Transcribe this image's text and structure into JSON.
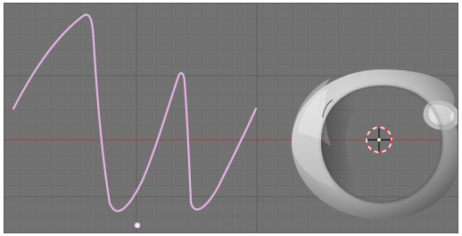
{
  "viewport": {
    "background_color": "#727272",
    "grid_color": "#6a6a6a",
    "major_grid_color": "#5e5e5e",
    "x_axis_color": "#9b4a4a"
  },
  "scene": {
    "objects": [
      {
        "name": "curve",
        "kind": "bezier-curve",
        "color": "#e6b3e6"
      },
      {
        "name": "torus-ring",
        "kind": "mesh",
        "color": "#d9d9d9"
      },
      {
        "name": "empty-origin",
        "kind": "origin-dot",
        "color": "#ffffff"
      }
    ],
    "cursor_3d": {
      "name": "3d-cursor",
      "ring_color_a": "#ff2a2a",
      "ring_color_b": "#ffffff",
      "crosshair_color": "#111111"
    }
  }
}
